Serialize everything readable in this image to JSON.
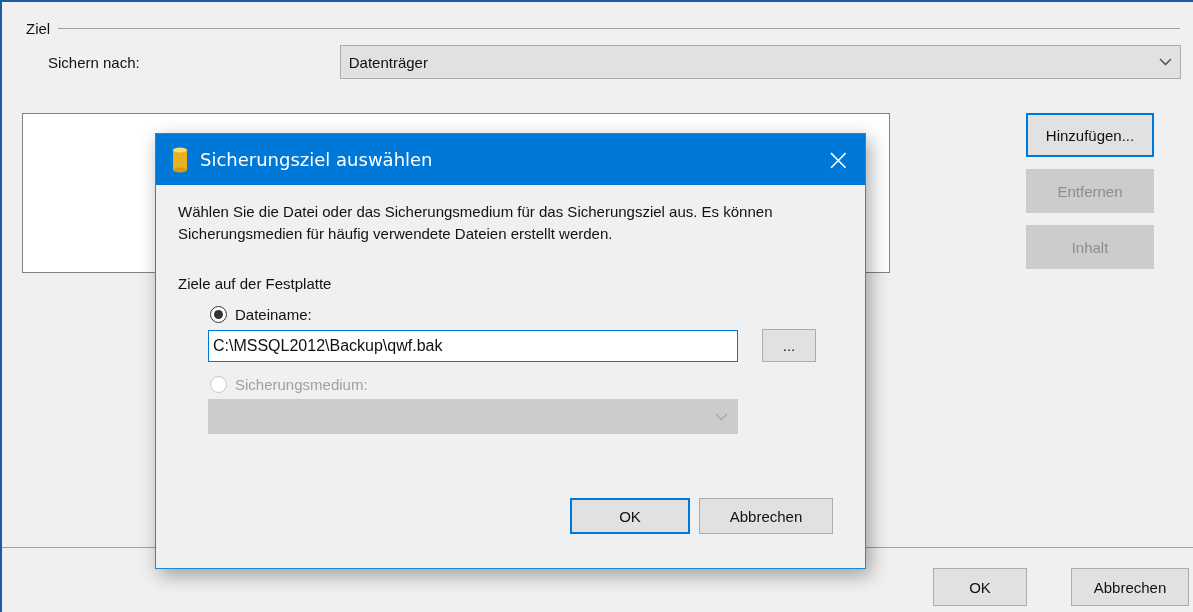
{
  "group": {
    "title": "Ziel"
  },
  "target": {
    "label": "Sichern nach:",
    "value": "Datenträger"
  },
  "side_buttons": [
    {
      "label": "Hinzufügen...",
      "disabled": false,
      "focused": true
    },
    {
      "label": "Entfernen",
      "disabled": true,
      "focused": false
    },
    {
      "label": "Inhalt",
      "disabled": true,
      "focused": false
    }
  ],
  "buttons": [
    {
      "label": "OK"
    },
    {
      "label": "Abbrechen"
    }
  ],
  "dialog": {
    "title": "Sicherungsziel auswählen",
    "close": "×",
    "description": "Wählen Sie die Datei oder das Sicherungsmedium für das Sicherungsziel aus. Es können Sicherungsmedien für häufig verwendete Dateien erstellt werden.",
    "section": "Ziele auf der Festplatte",
    "options": [
      {
        "label": "Dateiname:",
        "selected": true,
        "kind": "file",
        "value": "C:\\MSSQL2012\\Backup\\qwf.bak",
        "browse": "..."
      },
      {
        "label": "Sicherungsmedium:",
        "selected": false,
        "kind": "device"
      }
    ],
    "buttons": [
      {
        "label": "OK",
        "default": true
      },
      {
        "label": "Abbrechen",
        "default": false
      }
    ]
  }
}
